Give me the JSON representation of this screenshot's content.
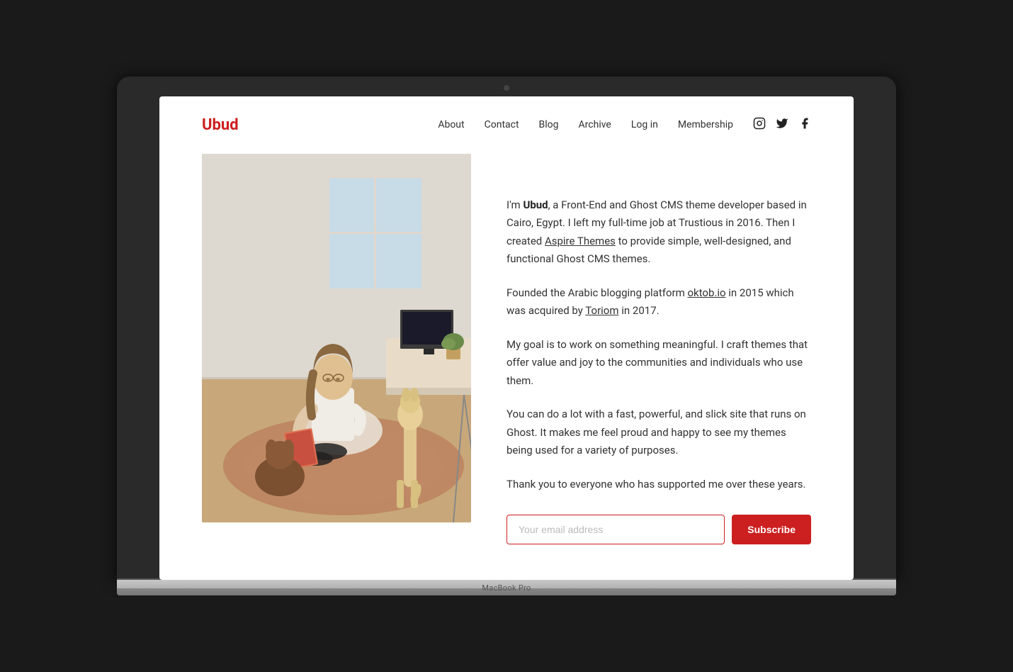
{
  "laptop": {
    "label": "MacBook Pro"
  },
  "site": {
    "logo": "Ubud",
    "nav": {
      "links": [
        {
          "label": "About",
          "href": "#"
        },
        {
          "label": "Contact",
          "href": "#"
        },
        {
          "label": "Blog",
          "href": "#"
        },
        {
          "label": "Archive",
          "href": "#"
        },
        {
          "label": "Log in",
          "href": "#"
        },
        {
          "label": "Membership",
          "href": "#"
        }
      ],
      "social_icons": [
        {
          "name": "instagram-icon",
          "symbol": "⬡"
        },
        {
          "name": "twitter-icon",
          "symbol": "𝕏"
        },
        {
          "name": "facebook-icon",
          "symbol": "f"
        }
      ]
    }
  },
  "bio": {
    "paragraph1_prefix": "I'm ",
    "brand_name": "Ubud",
    "paragraph1_main": ", a Front-End and Ghost CMS theme developer based in Cairo, Egypt. I left my full-time job at Trustious in 2016. Then I created ",
    "aspire_themes_link": "Aspire Themes",
    "paragraph1_suffix": " to provide simple, well-designed, and functional Ghost CMS themes.",
    "paragraph2_prefix": "Founded the Arabic blogging platform ",
    "oktob_link": "oktob.io",
    "paragraph2_mid": " in 2015 which was acquired by ",
    "toriom_link": "Toriom",
    "paragraph2_suffix": " in 2017.",
    "paragraph3": "My goal is to work on something meaningful. I craft themes that offer value and joy to the communities and individuals who use them.",
    "paragraph4": "You can do a lot with a fast, powerful, and slick site that runs on Ghost. It makes me feel proud and happy to see my themes being used for a variety of purposes.",
    "paragraph5": "Thank you to everyone who has supported me over these years.",
    "email_placeholder": "Your email address",
    "subscribe_label": "Subscribe"
  },
  "colors": {
    "brand_red": "#cc1f1f",
    "text_dark": "#333",
    "link_underline": "#333"
  }
}
